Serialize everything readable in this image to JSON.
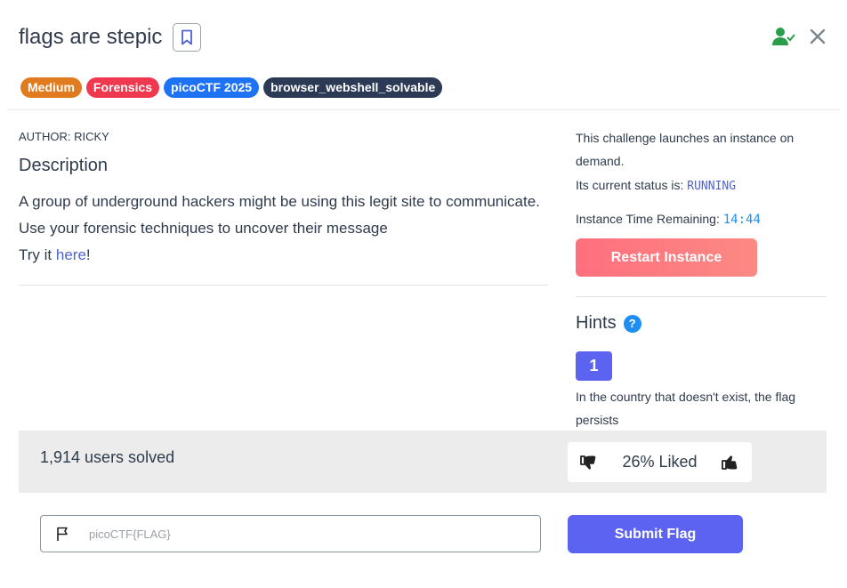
{
  "challenge": {
    "title": "flags are stepic",
    "tags": [
      {
        "label": "Medium",
        "color": "#e07b1f"
      },
      {
        "label": "Forensics",
        "color": "#f0384f"
      },
      {
        "label": "picoCTF 2025",
        "color": "#1e73f5"
      },
      {
        "label": "browser_webshell_solvable",
        "color": "#2c3a55"
      }
    ],
    "author": "AUTHOR: RICKY",
    "description_heading": "Description",
    "description_line1": "A group of underground hackers might be using this legit site to communicate.",
    "description_line2": "Use your forensic techniques to uncover their message",
    "try_prefix": "Try it ",
    "try_link": "here",
    "try_suffix": "!"
  },
  "instance": {
    "launch_text": "This challenge launches an instance on demand.",
    "status_label": "Its current status is: ",
    "status_value": "RUNNING",
    "time_label": "Instance Time Remaining: ",
    "time_value": "14:44",
    "restart_label": "Restart Instance"
  },
  "hints": {
    "heading": "Hints",
    "help_glyph": "?",
    "items": [
      {
        "number": "1",
        "text": "In the country that doesn't exist, the flag persists"
      }
    ]
  },
  "stats": {
    "solved_text": "1,914 users solved",
    "liked_text": "26% Liked"
  },
  "flag_form": {
    "placeholder": "picoCTF{FLAG}",
    "submit_label": "Submit Flag"
  },
  "colors": {
    "status_blue": "#4c63d2",
    "time_blue": "#1f8ef1",
    "accent": "#5b63f0",
    "user_check_green": "#2a9d4a"
  },
  "icons": [
    "bookmark-icon",
    "user-check-icon",
    "close-icon",
    "help-icon",
    "thumbs-down-icon",
    "thumbs-up-icon",
    "flag-icon"
  ]
}
